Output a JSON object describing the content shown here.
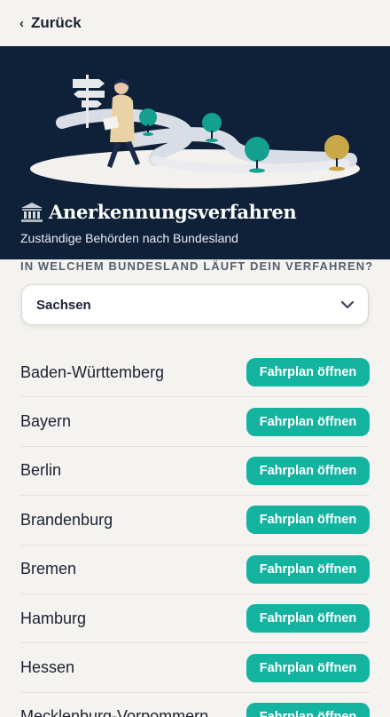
{
  "header": {
    "back_label": "Zurück"
  },
  "hero": {
    "title": "Anerkennungsverfahren",
    "subtitle": "Zuständige Behörden nach Bundesland",
    "title_icon": "bank-building-icon",
    "background": "#0f2139"
  },
  "filter": {
    "label": "IN WELCHEM BUNDESLAND LÄUFT DEIN VERFAHREN?",
    "selected": "Sachsen"
  },
  "states": [
    {
      "name": "Baden-Württemberg",
      "button": "Fahrplan öffnen"
    },
    {
      "name": "Bayern",
      "button": "Fahrplan öffnen"
    },
    {
      "name": "Berlin",
      "button": "Fahrplan öffnen"
    },
    {
      "name": "Brandenburg",
      "button": "Fahrplan öffnen"
    },
    {
      "name": "Bremen",
      "button": "Fahrplan öffnen"
    },
    {
      "name": "Hamburg",
      "button": "Fahrplan öffnen"
    },
    {
      "name": "Hessen",
      "button": "Fahrplan öffnen"
    },
    {
      "name": "Mecklenburg-Vorpommern",
      "button": "Fahrplan öffnen"
    }
  ],
  "colors": {
    "accent": "#13b3a0",
    "page_bg": "#f5f3ef"
  }
}
